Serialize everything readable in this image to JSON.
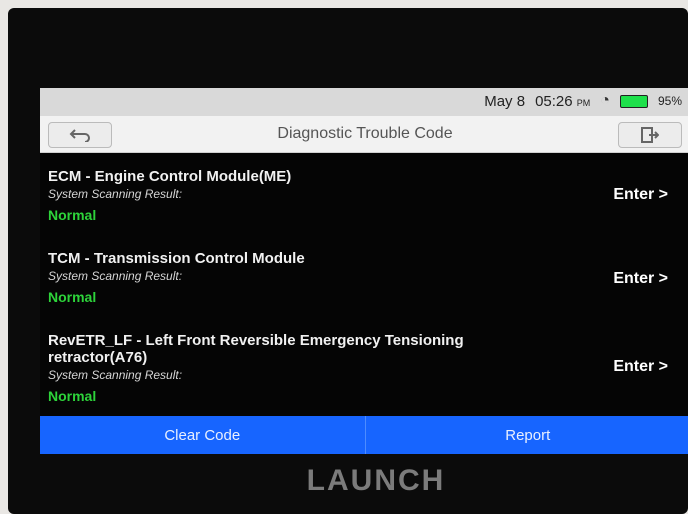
{
  "status_bar": {
    "date": "May 8",
    "time": "05:26",
    "ampm": "PM",
    "battery": "95%"
  },
  "header": {
    "title": "Diagnostic Trouble Code",
    "back_icon": "back-arrow-icon",
    "exit_icon": "exit-icon"
  },
  "modules": [
    {
      "name": "ECM - Engine Control Module(ME)",
      "label": "System Scanning Result:",
      "status": "Normal",
      "action": "Enter >"
    },
    {
      "name": "TCM - Transmission Control Module",
      "label": "System Scanning Result:",
      "status": "Normal",
      "action": "Enter >"
    },
    {
      "name": "RevETR_LF - Left Front Reversible Emergency Tensioning retractor(A76)",
      "label": "System Scanning Result:",
      "status": "Normal",
      "action": "Enter >"
    }
  ],
  "footer": {
    "clear_code": "Clear Code",
    "report": "Report"
  },
  "branding": {
    "logo_text": "LAUNCH"
  }
}
